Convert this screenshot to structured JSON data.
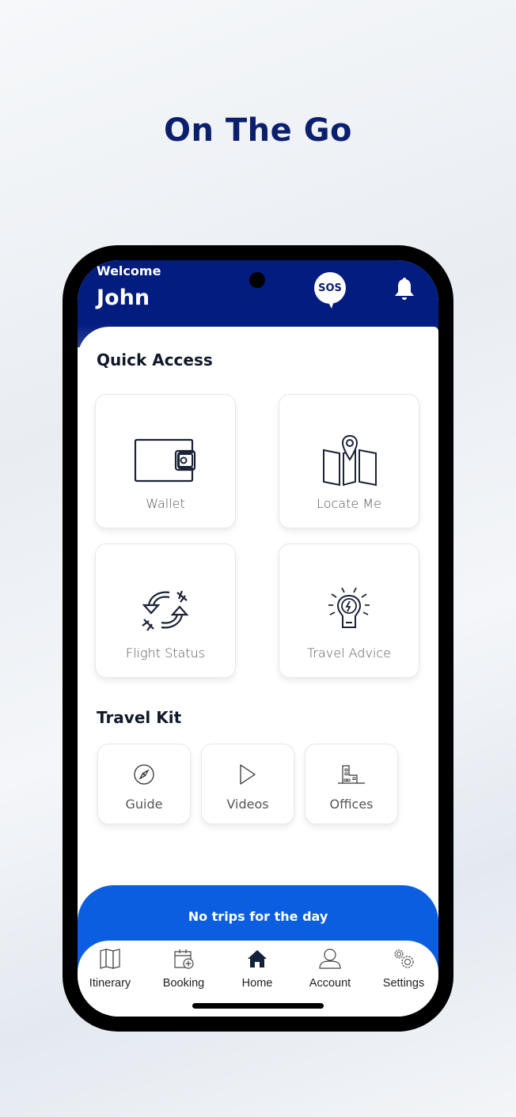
{
  "headline": "On The Go",
  "header": {
    "welcome": "Welcome",
    "username": "John",
    "sos_label": "SOS",
    "bell_icon": "bell-icon"
  },
  "quick_access": {
    "title": "Quick Access",
    "items": [
      {
        "label": "Wallet",
        "icon": "wallet-icon"
      },
      {
        "label": "Locate Me",
        "icon": "map-pin-icon"
      },
      {
        "label": "Flight Status",
        "icon": "flight-status-icon"
      },
      {
        "label": "Travel Advice",
        "icon": "lightbulb-icon"
      }
    ]
  },
  "travel_kit": {
    "title": "Travel Kit",
    "items": [
      {
        "label": "Guide",
        "icon": "compass-icon"
      },
      {
        "label": "Videos",
        "icon": "play-icon"
      },
      {
        "label": "Offices",
        "icon": "building-icon"
      }
    ]
  },
  "trips_banner": "No trips for the day",
  "tabs": [
    {
      "label": "Itinerary",
      "icon": "map-icon",
      "active": false
    },
    {
      "label": "Booking",
      "icon": "calendar-plus-icon",
      "active": false
    },
    {
      "label": "Home",
      "icon": "home-icon",
      "active": true
    },
    {
      "label": "Account",
      "icon": "user-icon",
      "active": false
    },
    {
      "label": "Settings",
      "icon": "gears-icon",
      "active": false
    }
  ],
  "colors": {
    "brand_navy": "#021c80",
    "accent_blue": "#0c5ee0",
    "headline": "#0b1f6e"
  }
}
